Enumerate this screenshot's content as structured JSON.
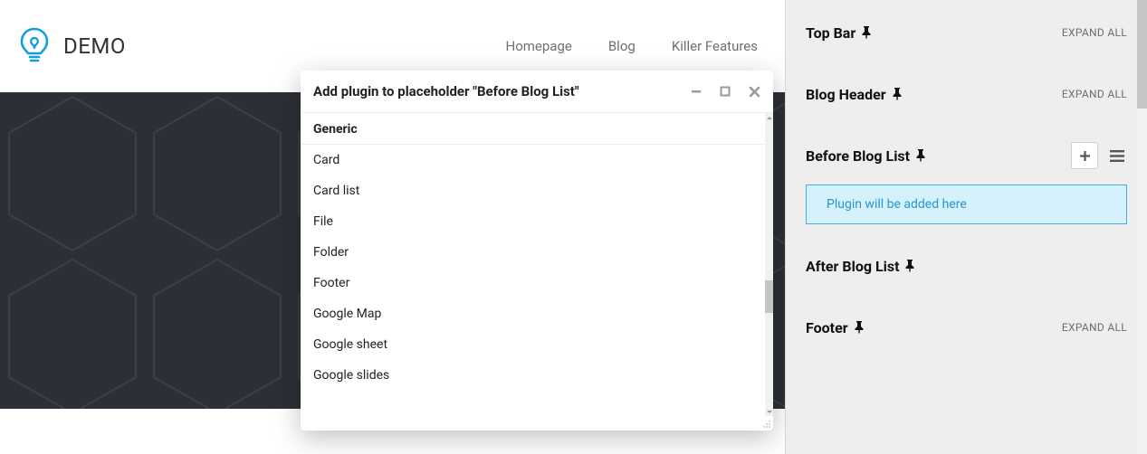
{
  "site": {
    "brand": "DEMO",
    "nav": [
      {
        "label": "Homepage"
      },
      {
        "label": "Blog"
      },
      {
        "label": "Killer Features"
      }
    ]
  },
  "modal": {
    "title": "Add plugin to placeholder \"Before Blog List\"",
    "category": "Generic",
    "items": [
      "Card",
      "Card list",
      "File",
      "Folder",
      "Footer",
      "Google Map",
      "Google sheet",
      "Google slides"
    ]
  },
  "sidebar": {
    "expand_all": "EXPAND ALL",
    "sections": [
      {
        "name": "Top Bar",
        "expand": true,
        "controls": false,
        "active_drop": false
      },
      {
        "name": "Blog Header",
        "expand": true,
        "controls": false,
        "active_drop": false
      },
      {
        "name": "Before Blog List",
        "expand": false,
        "controls": true,
        "active_drop": true
      },
      {
        "name": "After Blog List",
        "expand": false,
        "controls": false,
        "active_drop": false
      },
      {
        "name": "Footer",
        "expand": true,
        "controls": false,
        "active_drop": false
      }
    ],
    "drop_message": "Plugin will be added here"
  }
}
